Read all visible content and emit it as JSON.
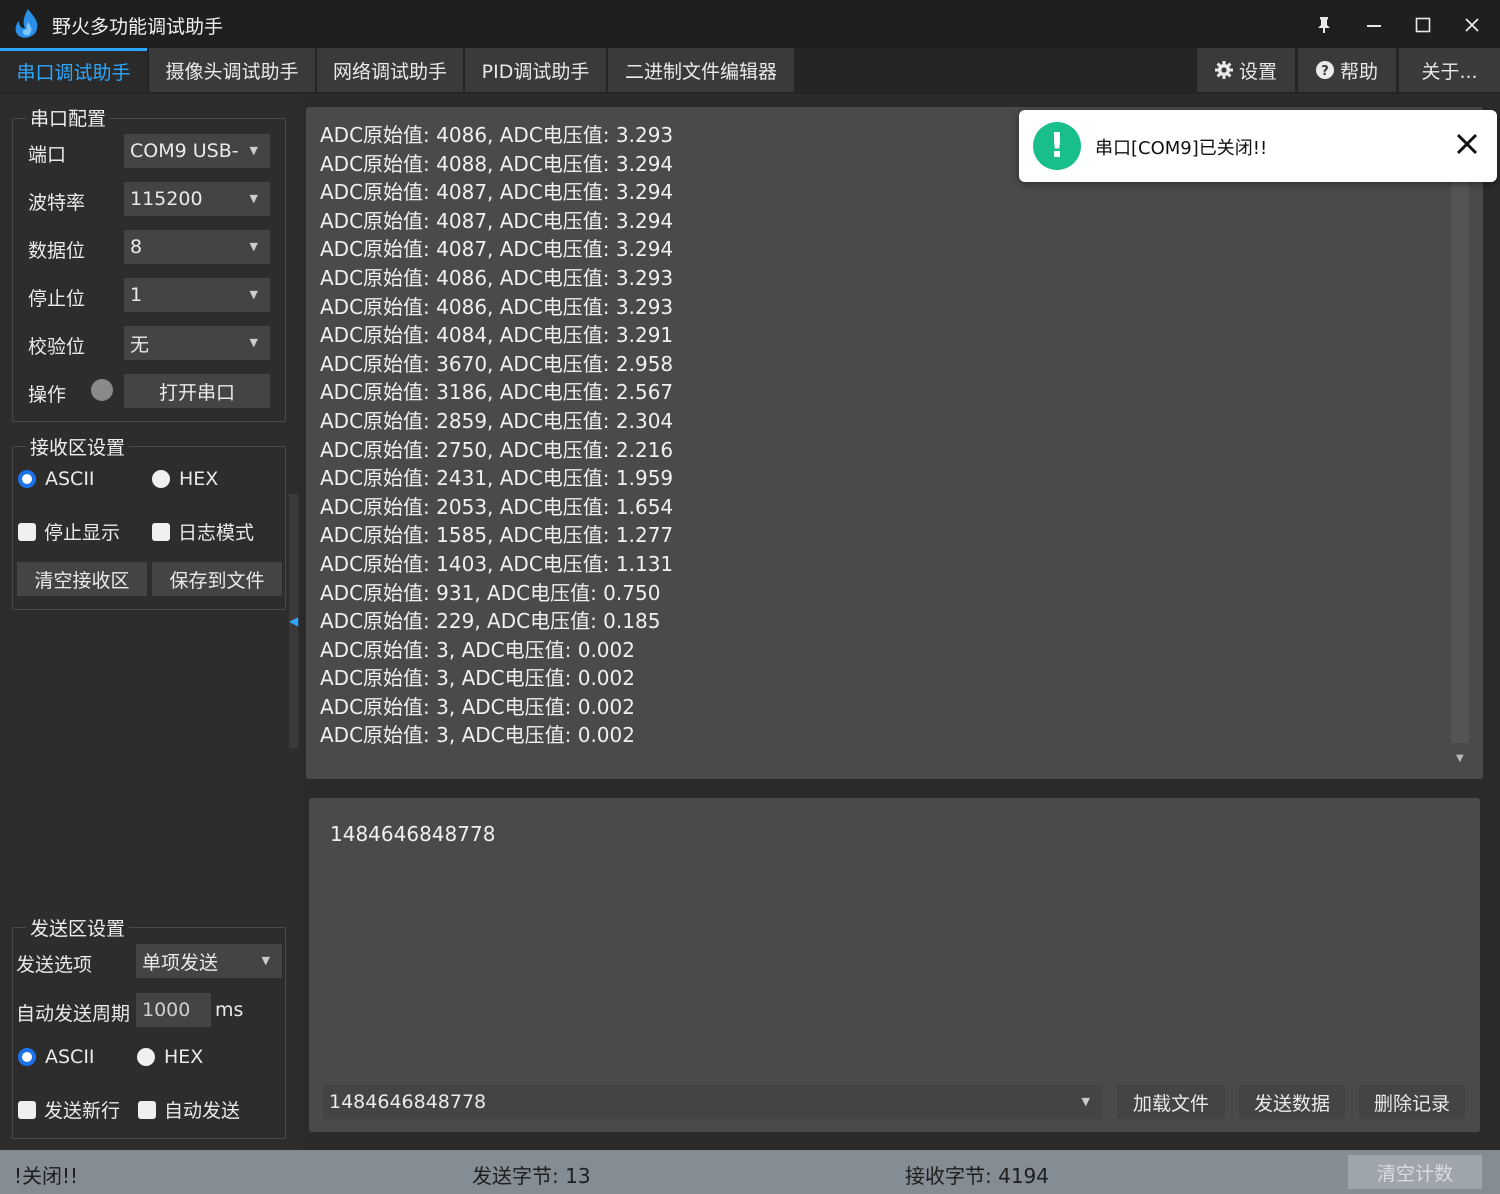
{
  "window": {
    "title": "野火多功能调试助手",
    "controls": {
      "pin": "🖈",
      "minimize": "—",
      "maximize": "☐",
      "close": "✕"
    }
  },
  "tabs": [
    {
      "label": "串口调试助手",
      "active": true
    },
    {
      "label": "摄像头调试助手"
    },
    {
      "label": "网络调试助手"
    },
    {
      "label": "PID调试助手"
    },
    {
      "label": "二进制文件编辑器"
    }
  ],
  "top_actions": {
    "settings": "设置",
    "help": "帮助",
    "about": "关于..."
  },
  "serial_config": {
    "title": "串口配置",
    "port_label": "端口",
    "port_value": "COM9 USB-",
    "baud_label": "波特率",
    "baud_value": "115200",
    "data_label": "数据位",
    "data_value": "8",
    "stop_label": "停止位",
    "stop_value": "1",
    "parity_label": "校验位",
    "parity_value": "无",
    "op_label": "操作",
    "open_button": "打开串口"
  },
  "recv_settings": {
    "title": "接收区设置",
    "ascii": "ASCII",
    "hex": "HEX",
    "stop_display": "停止显示",
    "log_mode": "日志模式",
    "clear": "清空接收区",
    "save": "保存到文件"
  },
  "send_settings": {
    "title": "发送区设置",
    "option_label": "发送选项",
    "option_value": "单项发送",
    "period_label": "自动发送周期",
    "period_value": "1000",
    "period_unit": "ms",
    "ascii": "ASCII",
    "hex": "HEX",
    "newline": "发送新行",
    "auto_send": "自动发送"
  },
  "recv_lines": [
    "ADC原始值: 4086, ADC电压值: 3.293",
    "ADC原始值: 4088, ADC电压值: 3.294",
    "ADC原始值: 4087, ADC电压值: 3.294",
    "ADC原始值: 4087, ADC电压值: 3.294",
    "ADC原始值: 4087, ADC电压值: 3.294",
    "ADC原始值: 4086, ADC电压值: 3.293",
    "ADC原始值: 4086, ADC电压值: 3.293",
    "ADC原始值: 4084, ADC电压值: 3.291",
    "ADC原始值: 3670, ADC电压值: 2.958",
    "ADC原始值: 3186, ADC电压值: 2.567",
    "ADC原始值: 2859, ADC电压值: 2.304",
    "ADC原始值: 2750, ADC电压值: 2.216",
    "ADC原始值: 2431, ADC电压值: 1.959",
    "ADC原始值: 2053, ADC电压值: 1.654",
    "ADC原始值: 1585, ADC电压值: 1.277",
    "ADC原始值: 1403, ADC电压值: 1.131",
    "ADC原始值: 931, ADC电压值: 0.750",
    "ADC原始值: 229, ADC电压值: 0.185",
    "ADC原始值: 3, ADC电压值: 0.002",
    "ADC原始值: 3, ADC电压值: 0.002",
    "ADC原始值: 3, ADC电压值: 0.002",
    "ADC原始值: 3, ADC电压值: 0.002"
  ],
  "toast": {
    "message": "串口[COM9]已关闭!!",
    "close": "✕"
  },
  "send_area": {
    "text": "1484646848778",
    "history_value": "1484646848778",
    "load_file": "加载文件",
    "send_data": "发送数据",
    "delete_history": "删除记录"
  },
  "status": {
    "message": "!关闭!!",
    "sent": "发送字节: 13",
    "received": "接收字节: 4194",
    "clear_count": "清空计数"
  },
  "colors": {
    "accent": "#2ea8ff",
    "success": "#19bf8a",
    "radio_on": "#1a73e8"
  }
}
